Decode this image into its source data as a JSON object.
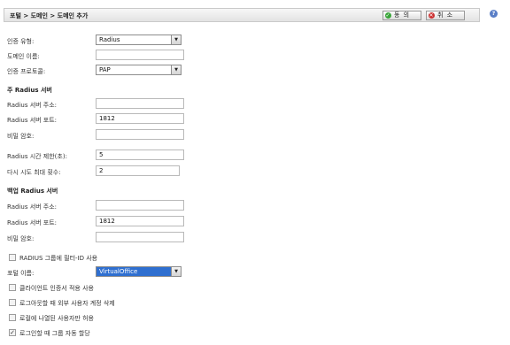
{
  "header": {
    "breadcrumb": "포털 > 도메인 > 도메인 추가",
    "ok_label": "동 의",
    "cancel_label": "취 소",
    "help": "?"
  },
  "form": {
    "auth_type": {
      "label": "인증 유형:",
      "value": "Radius"
    },
    "domain_name": {
      "label": "도메인 이름:",
      "value": ""
    },
    "auth_protocol": {
      "label": "인증 프로토콜:",
      "value": "PAP"
    },
    "primary_section": "주 Radius 서버",
    "primary": {
      "address": {
        "label": "Radius 서버 주소:",
        "value": ""
      },
      "port": {
        "label": "Radius 서버 포트:",
        "value": "1812"
      },
      "secret": {
        "label": "비밀 암호:",
        "value": ""
      }
    },
    "timeout": {
      "label": "Radius 시간 제한(초):",
      "value": "5"
    },
    "retries": {
      "label": "다시 시도 최대 횟수:",
      "value": "2"
    },
    "backup_section": "백업 Radius 서버",
    "backup": {
      "address": {
        "label": "Radius 서버 주소:",
        "value": ""
      },
      "port": {
        "label": "Radius 서버 포트:",
        "value": "1812"
      },
      "secret": {
        "label": "비밀 암호:",
        "value": ""
      }
    },
    "radius_filter_id": {
      "label": "RADIUS 그룹에 필터-ID 사용",
      "checked": false
    },
    "portal_name": {
      "label": "포털 이름:",
      "value": "VirtualOffice"
    },
    "client_cert": {
      "label": "클라이언트 인증서 적용 사용",
      "checked": false
    },
    "delete_external": {
      "label": "로그아웃할 때 외부 사용자 계정 삭제",
      "checked": false
    },
    "only_listed": {
      "label": "로컬에 나열된 사용자만 허용",
      "checked": false
    },
    "auto_assign": {
      "label": "로그인할 때 그룹 자동 할당",
      "checked": true
    }
  },
  "icons": {
    "select_arrow": "▼",
    "check": "✓",
    "ok_icon": "✓",
    "cancel_icon": "✕"
  }
}
